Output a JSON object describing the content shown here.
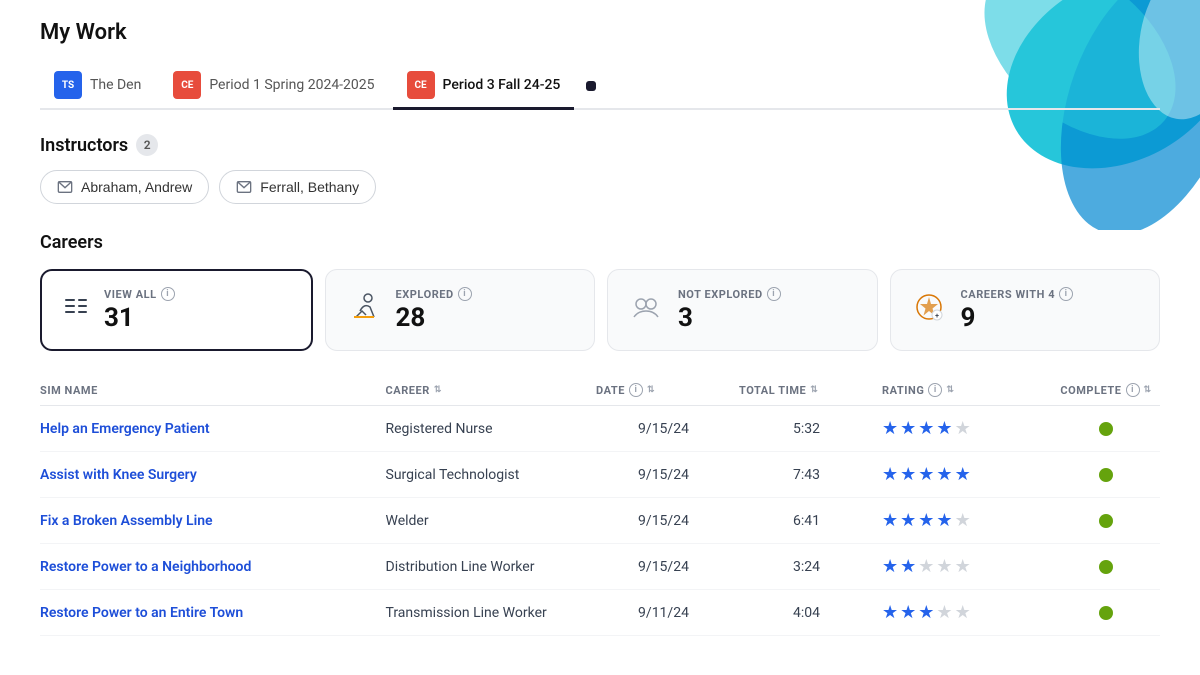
{
  "page": {
    "title": "My Work"
  },
  "tabs": [
    {
      "id": "the-den",
      "label": "The Den",
      "icon_letters": "TS",
      "icon_class": "ts",
      "active": false
    },
    {
      "id": "period1",
      "label": "Period 1 Spring 2024-2025",
      "icon_letters": "CE",
      "icon_class": "ce",
      "active": false
    },
    {
      "id": "period3",
      "label": "Period 3 Fall 24-25",
      "icon_letters": "CE",
      "icon_class": "ce",
      "active": true
    }
  ],
  "instructors": {
    "label": "Instructors",
    "count": "2",
    "list": [
      {
        "name": "Abraham, Andrew"
      },
      {
        "name": "Ferrall, Bethany"
      }
    ]
  },
  "careers": {
    "label": "Careers",
    "cards": [
      {
        "id": "view-all",
        "icon": "≡",
        "label": "VIEW ALL",
        "count": "31",
        "active": true
      },
      {
        "id": "explored",
        "icon": "🏃",
        "label": "EXPLORED",
        "count": "28",
        "active": false
      },
      {
        "id": "not-explored",
        "icon": "👥",
        "label": "NOT EXPLORED",
        "count": "3",
        "active": false
      },
      {
        "id": "careers-with-4",
        "icon": "🏅",
        "label": "CAREERS WITH 4",
        "count": "9",
        "active": false
      }
    ]
  },
  "table": {
    "columns": [
      {
        "id": "sim-name",
        "label": "SIM NAME",
        "sortable": false
      },
      {
        "id": "career",
        "label": "CAREER",
        "sortable": true
      },
      {
        "id": "date",
        "label": "DATE",
        "sortable": true
      },
      {
        "id": "total-time",
        "label": "TOTAL TIME",
        "sortable": true
      },
      {
        "id": "rating",
        "label": "RATING",
        "sortable": true,
        "has_info": true
      },
      {
        "id": "complete",
        "label": "COMPLETE",
        "sortable": true,
        "has_info": true
      }
    ],
    "rows": [
      {
        "sim_name": "Help an Emergency Patient",
        "career": "Registered Nurse",
        "date": "9/15/24",
        "total_time": "5:32",
        "rating": 3.5,
        "complete": true
      },
      {
        "sim_name": "Assist with Knee Surgery",
        "career": "Surgical Technologist",
        "date": "9/15/24",
        "total_time": "7:43",
        "rating": 4.5,
        "complete": true
      },
      {
        "sim_name": "Fix a Broken Assembly Line",
        "career": "Welder",
        "date": "9/15/24",
        "total_time": "6:41",
        "rating": 3.5,
        "complete": true
      },
      {
        "sim_name": "Restore Power to a Neighborhood",
        "career": "Distribution Line Worker",
        "date": "9/15/24",
        "total_time": "3:24",
        "rating": 2,
        "complete": true
      },
      {
        "sim_name": "Restore Power to an Entire Town",
        "career": "Transmission Line Worker",
        "date": "9/11/24",
        "total_time": "4:04",
        "rating": 2.5,
        "complete": true
      }
    ]
  },
  "colors": {
    "accent": "#1a1a2e",
    "link": "#1d4ed8",
    "star_filled": "#2563eb",
    "star_empty": "#d1d5db",
    "complete_green": "#65a30d"
  }
}
